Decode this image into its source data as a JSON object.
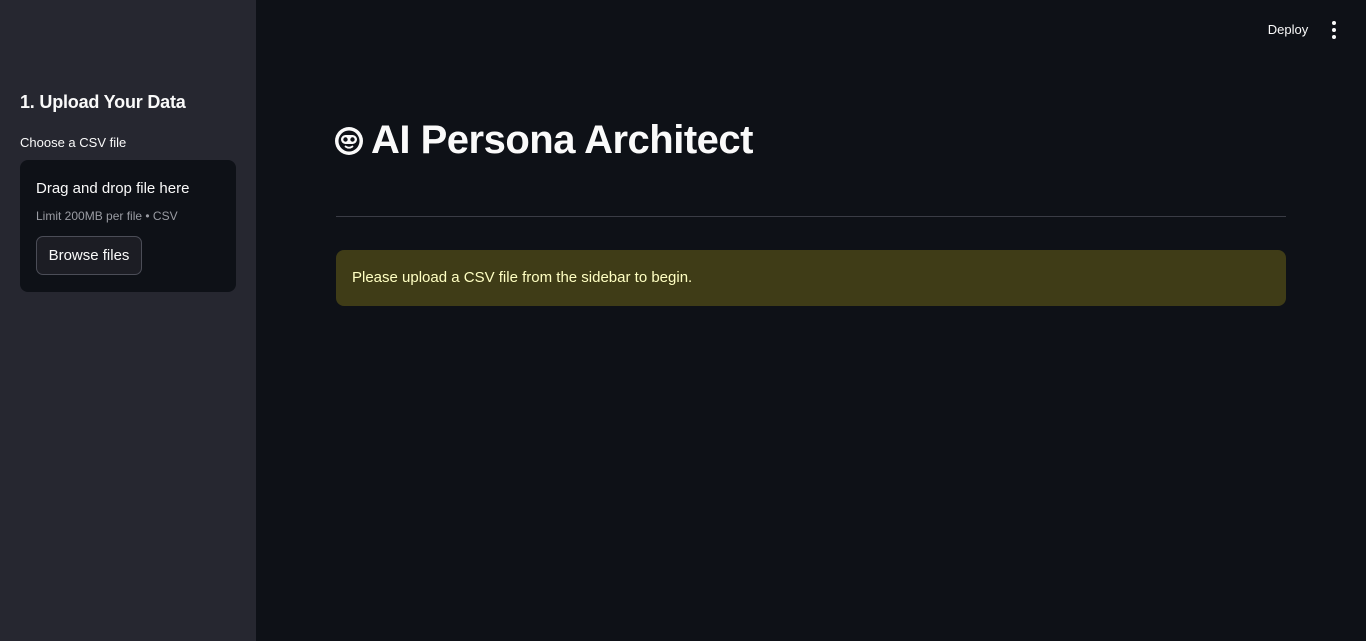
{
  "toolbar": {
    "deploy_label": "Deploy",
    "menu_icon": "more-vertical-icon"
  },
  "sidebar": {
    "heading": "1. Upload Your Data",
    "uploader": {
      "label": "Choose a CSV file",
      "drop_text": "Drag and drop file here",
      "limit_text": "Limit 200MB per file • CSV",
      "browse_label": "Browse files"
    }
  },
  "main": {
    "title_icon": "robot-face-icon",
    "title": "AI Persona Architect",
    "alert": {
      "message": "Please upload a CSV file from the sidebar to begin.",
      "color": "#3f3c17",
      "text_color": "#ffffc2"
    }
  },
  "colors": {
    "background": "#0e1117",
    "sidebar": "#262730",
    "text": "#fafafa"
  }
}
